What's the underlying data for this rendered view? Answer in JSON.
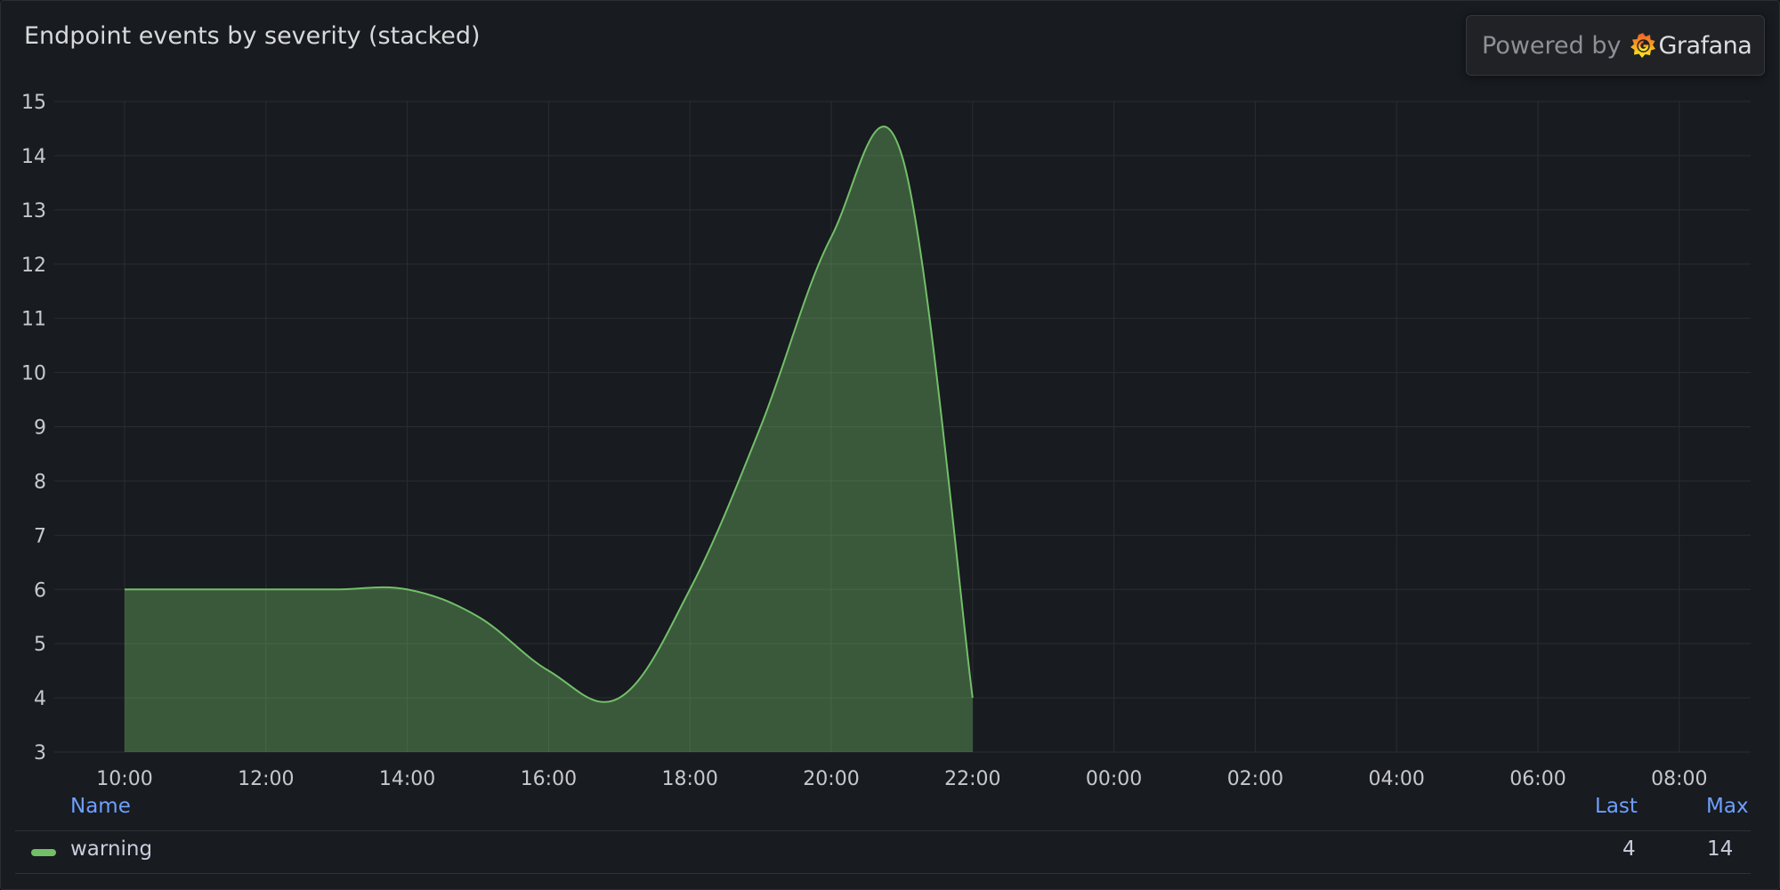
{
  "panel": {
    "title": "Endpoint events by severity (stacked)"
  },
  "branding": {
    "powered_by": "Powered by",
    "logo_icon": "grafana-logo-icon",
    "brand_name": "Grafana"
  },
  "legend": {
    "columns": {
      "name": "Name",
      "last": "Last",
      "max": "Max"
    },
    "rows": [
      {
        "name": "warning",
        "last": "4",
        "max": "14",
        "color": "#73bf69"
      }
    ]
  },
  "colors": {
    "series": "#73bf69",
    "fill": "#73bf69",
    "legend_header": "#6e9fff",
    "background": "#181b1f"
  },
  "chart_data": {
    "type": "area",
    "title": "Endpoint events by severity (stacked)",
    "xlabel": "",
    "ylabel": "",
    "ylim": [
      3,
      15
    ],
    "yticks": [
      3,
      4,
      5,
      6,
      7,
      8,
      9,
      10,
      11,
      12,
      13,
      14,
      15
    ],
    "x_tick_labels": [
      "10:00",
      "12:00",
      "14:00",
      "16:00",
      "18:00",
      "20:00",
      "22:00",
      "00:00",
      "02:00",
      "04:00",
      "06:00",
      "08:00"
    ],
    "grid": true,
    "legend_placement": "bottom",
    "series": [
      {
        "name": "warning",
        "color": "#73bf69",
        "x": [
          "10:00",
          "11:00",
          "12:00",
          "13:00",
          "14:00",
          "15:00",
          "16:00",
          "17:00",
          "18:00",
          "19:00",
          "20:00",
          "21:00",
          "22:00"
        ],
        "values": [
          6,
          6,
          6,
          6,
          6,
          5.5,
          4.5,
          4,
          6,
          9,
          12.5,
          14,
          4
        ]
      }
    ]
  }
}
